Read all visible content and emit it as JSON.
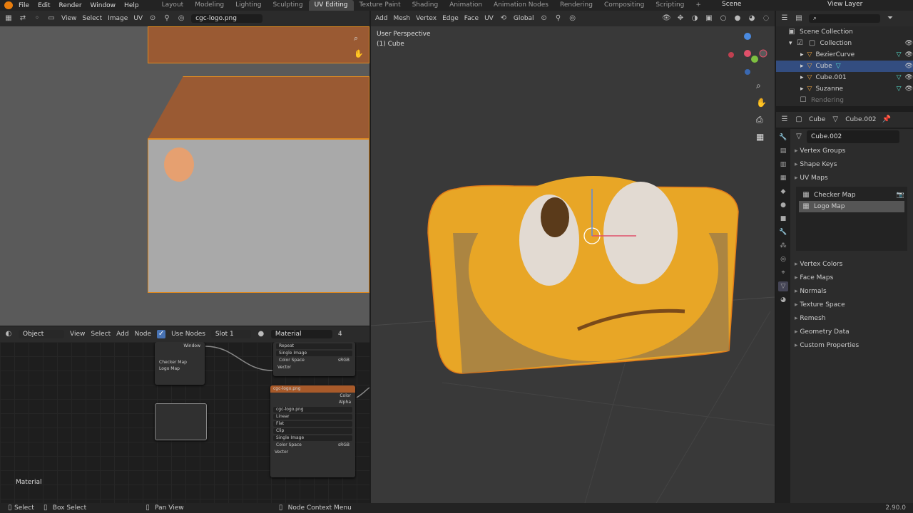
{
  "menu": {
    "file": "File",
    "edit": "Edit",
    "render": "Render",
    "window": "Window",
    "help": "Help"
  },
  "workspaces": [
    "Layout",
    "Modeling",
    "Lighting",
    "Sculpting",
    "UV Editing",
    "Texture Paint",
    "Shading",
    "Animation",
    "Animation Nodes",
    "Rendering",
    "Compositing",
    "Scripting"
  ],
  "scene": "Scene",
  "view_layer": "View Layer",
  "uv_header": {
    "view": "View",
    "select": "Select",
    "image": "Image",
    "uv": "UV",
    "image_name": "cgc-logo.png"
  },
  "vp_header": {
    "add": "Add",
    "mesh": "Mesh",
    "vertex": "Vertex",
    "edge": "Edge",
    "face": "Face",
    "uv": "UV",
    "orientation": "Global"
  },
  "vp_info": {
    "perspective": "User Perspective",
    "object": "(1) Cube"
  },
  "node_header": {
    "object": "Object",
    "view": "View",
    "select": "Select",
    "add": "Add",
    "node": "Node",
    "use_nodes": "Use Nodes",
    "slot": "Slot 1",
    "material": "Material",
    "count": "4"
  },
  "node_label": "Material",
  "nodes": {
    "uvmap": {
      "window": "Window",
      "items": [
        "Checker Map",
        "Logo Map"
      ]
    },
    "img1": {
      "repeat": "Repeat",
      "single": "Single Image",
      "colorspace_label": "Color Space",
      "colorspace": "sRGB",
      "vector": "Vector"
    },
    "img2": {
      "title": "cgc-logo.png",
      "color": "Color",
      "alpha": "Alpha",
      "file": "cgc-logo.png",
      "interp": "Linear",
      "proj": "Flat",
      "ext": "Clip",
      "source": "Single Image",
      "colorspace_label": "Color Space",
      "colorspace": "sRGB",
      "vector": "Vector"
    }
  },
  "outliner": {
    "scene_collection": "Scene Collection",
    "collection": "Collection",
    "items": [
      "BezierCurve",
      "Cube",
      "Cube.001",
      "Suzanne"
    ],
    "rendering": "Rendering"
  },
  "props": {
    "object": "Cube",
    "mesh": "Cube.002",
    "mesh_field": "Cube.002",
    "sections_top": [
      "Vertex Groups",
      "Shape Keys",
      "UV Maps"
    ],
    "uvmaps": [
      "Checker Map",
      "Logo Map"
    ],
    "sections_bottom": [
      "Vertex Colors",
      "Face Maps",
      "Normals",
      "Texture Space",
      "Remesh",
      "Geometry Data",
      "Custom Properties"
    ]
  },
  "status": {
    "select": "Select",
    "box_select": "Box Select",
    "pan_view": "Pan View",
    "node_context": "Node Context Menu",
    "version": "2.90.0"
  }
}
